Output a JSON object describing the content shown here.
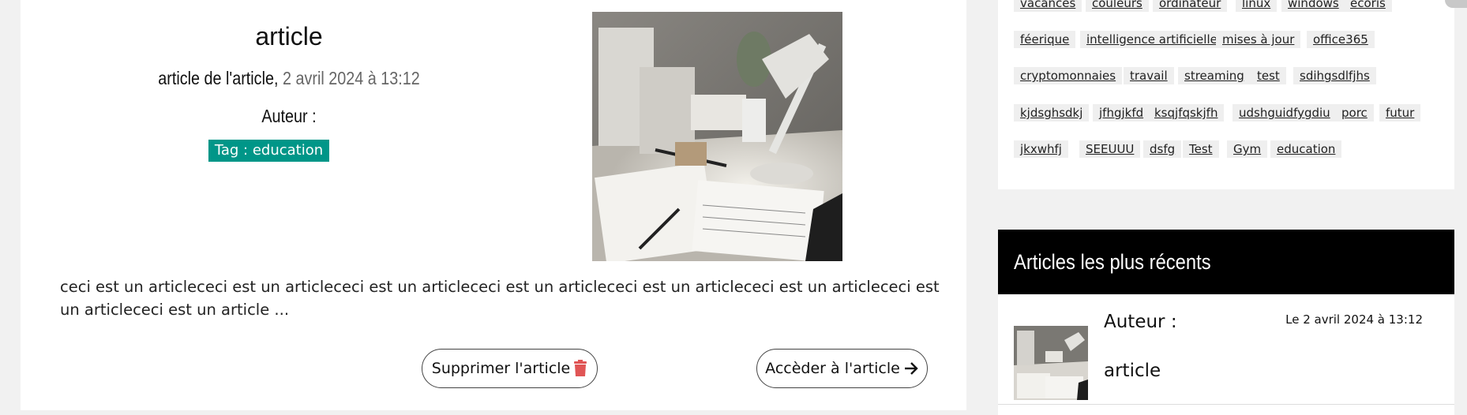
{
  "article": {
    "title": "article",
    "subtitle": "article de l'article,",
    "date": "2 avril 2024 à 13:12",
    "author_label": "Auteur :",
    "tag_label": "Tag : education",
    "excerpt": "ceci est un articlececi est un articlececi est un articlececi est un articlececi est un articlececi est un articlececi est un articlececi est un article ...",
    "delete_label": "Supprimer l'article",
    "open_label": "Accèder à l'article"
  },
  "tags": [
    "vacances",
    "couleurs",
    "ordinateur",
    "linux",
    "windows",
    "ecoris",
    "féerique",
    "intelligence artificielle",
    "mises à jour",
    "office365",
    "cryptomonnaies",
    "travail",
    "streaming",
    "test",
    "sdihgsdlfjhs",
    "kjdsghsdkj",
    "jfhgjkfd",
    "ksqjfqskjfh",
    "udshguidfygdiu",
    "porc",
    "futur",
    "jkxwhfj",
    "SEEUUU",
    "dsfg",
    "Test",
    "Gym",
    "education"
  ],
  "recent": {
    "heading": "Articles les plus récents",
    "author_label": "Auteur :",
    "date": "Le 2 avril 2024 à 13:12",
    "title": "article"
  },
  "colors": {
    "tag_badge": "#009688",
    "trash_icon": "#e05555",
    "recent_header_bg": "#000000",
    "page_bg": "#f1f1f1"
  }
}
